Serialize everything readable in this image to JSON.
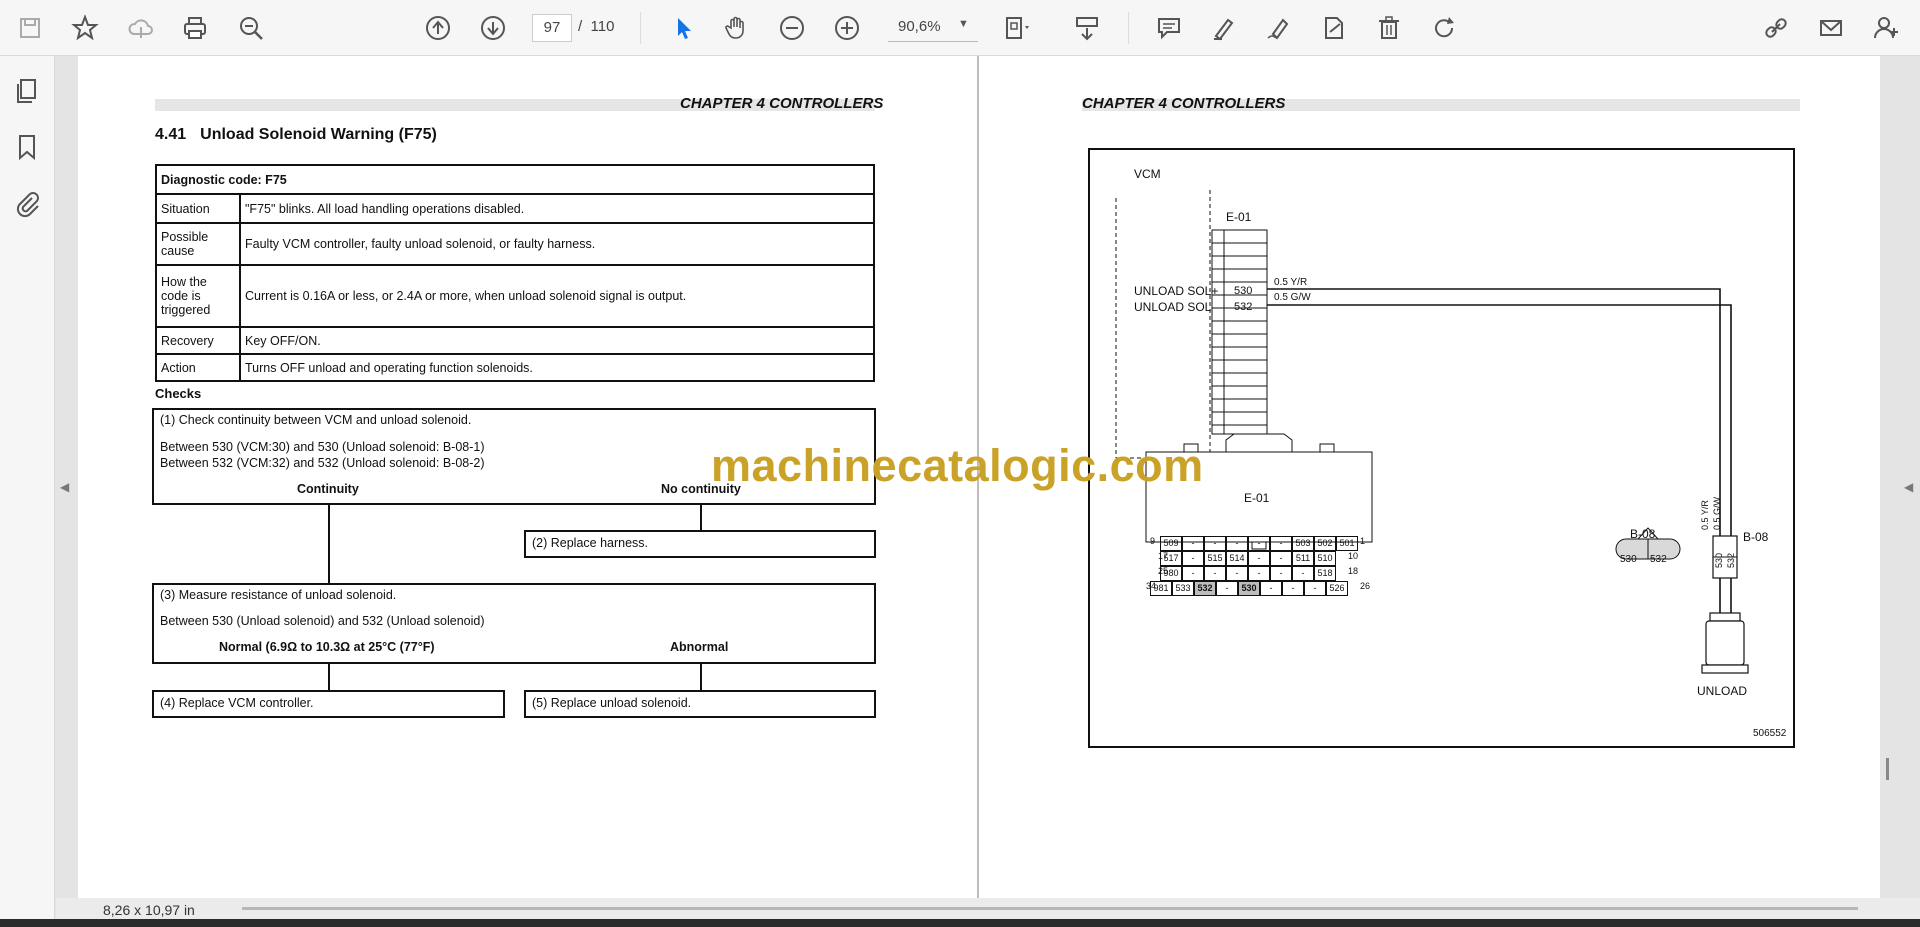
{
  "toolbar": {
    "page_current": "97",
    "page_separator": "/",
    "page_total": "110",
    "zoom": "90,6%"
  },
  "status": {
    "page_size": "8,26 x 10,97 in"
  },
  "left_page": {
    "chapter": "CHAPTER 4 CONTROLLERS",
    "section_number": "4.41",
    "section_title": "Unload Solenoid Warning (F75)",
    "diag_code": "Diagnostic code: F75",
    "rows": [
      {
        "key": "Situation",
        "value": "\"F75\" blinks. All load handling operations disabled."
      },
      {
        "key": "Possible cause",
        "value": "Faulty VCM controller, faulty unload solenoid, or faulty harness."
      },
      {
        "key": "How the code is triggered",
        "value": "Current is 0.16A or less, or 2.4A or more, when unload solenoid signal is output."
      },
      {
        "key": "Recovery",
        "value": "Key OFF/ON."
      },
      {
        "key": "Action",
        "value": "Turns OFF unload and operating function solenoids."
      }
    ],
    "checks_label": "Checks",
    "step1": {
      "title": "(1) Check continuity between VCM and unload solenoid.",
      "line1": "Between 530 (VCM:30) and 530 (Unload solenoid: B-08-1)",
      "line2": "Between 532 (VCM:32) and 532 (Unload solenoid: B-08-2)",
      "ok": "Continuity",
      "ng": "No continuity"
    },
    "step2": "(2) Replace harness.",
    "step3": {
      "title": "(3) Measure resistance of unload solenoid.",
      "line1": "Between 530 (Unload solenoid) and 532 (Unload solenoid)",
      "ok": "Normal (6.9Ω to 10.3Ω at 25°C (77°F)",
      "ng": "Abnormal"
    },
    "step4": "(4) Replace VCM controller.",
    "step5": "(5) Replace unload solenoid."
  },
  "right_page": {
    "chapter": "CHAPTER 4 CONTROLLERS",
    "diagram": {
      "vcm": "VCM",
      "connector_top": "E-01",
      "sol_plus": "UNLOAD SOL+",
      "sol_minus": "UNLOAD SOL-",
      "pin_530": "530",
      "pin_532": "532",
      "wire_yr": "0.5 Y/R",
      "wire_gw": "0.5 G/W",
      "connector_bottom": "E-01",
      "b08_left": "B-08",
      "b08_right": "B-08",
      "unload": "UNLOAD",
      "figure_id": "506552",
      "row_numbers": [
        "9",
        "17",
        "25",
        "34",
        "1",
        "10",
        "18",
        "26"
      ],
      "grid": [
        [
          "509",
          "-",
          "-",
          "-",
          "-",
          "-",
          "503",
          "502",
          "501"
        ],
        [
          "517",
          "-",
          "515",
          "514",
          "-",
          "-",
          "511",
          "510"
        ],
        [
          "980",
          "-",
          "-",
          "-",
          "-",
          "-",
          "-",
          "518"
        ],
        [
          "981",
          "533",
          "532",
          "-",
          "530",
          "-",
          "-",
          "-",
          "526"
        ]
      ]
    }
  },
  "watermark": "machinecatalogic.com"
}
